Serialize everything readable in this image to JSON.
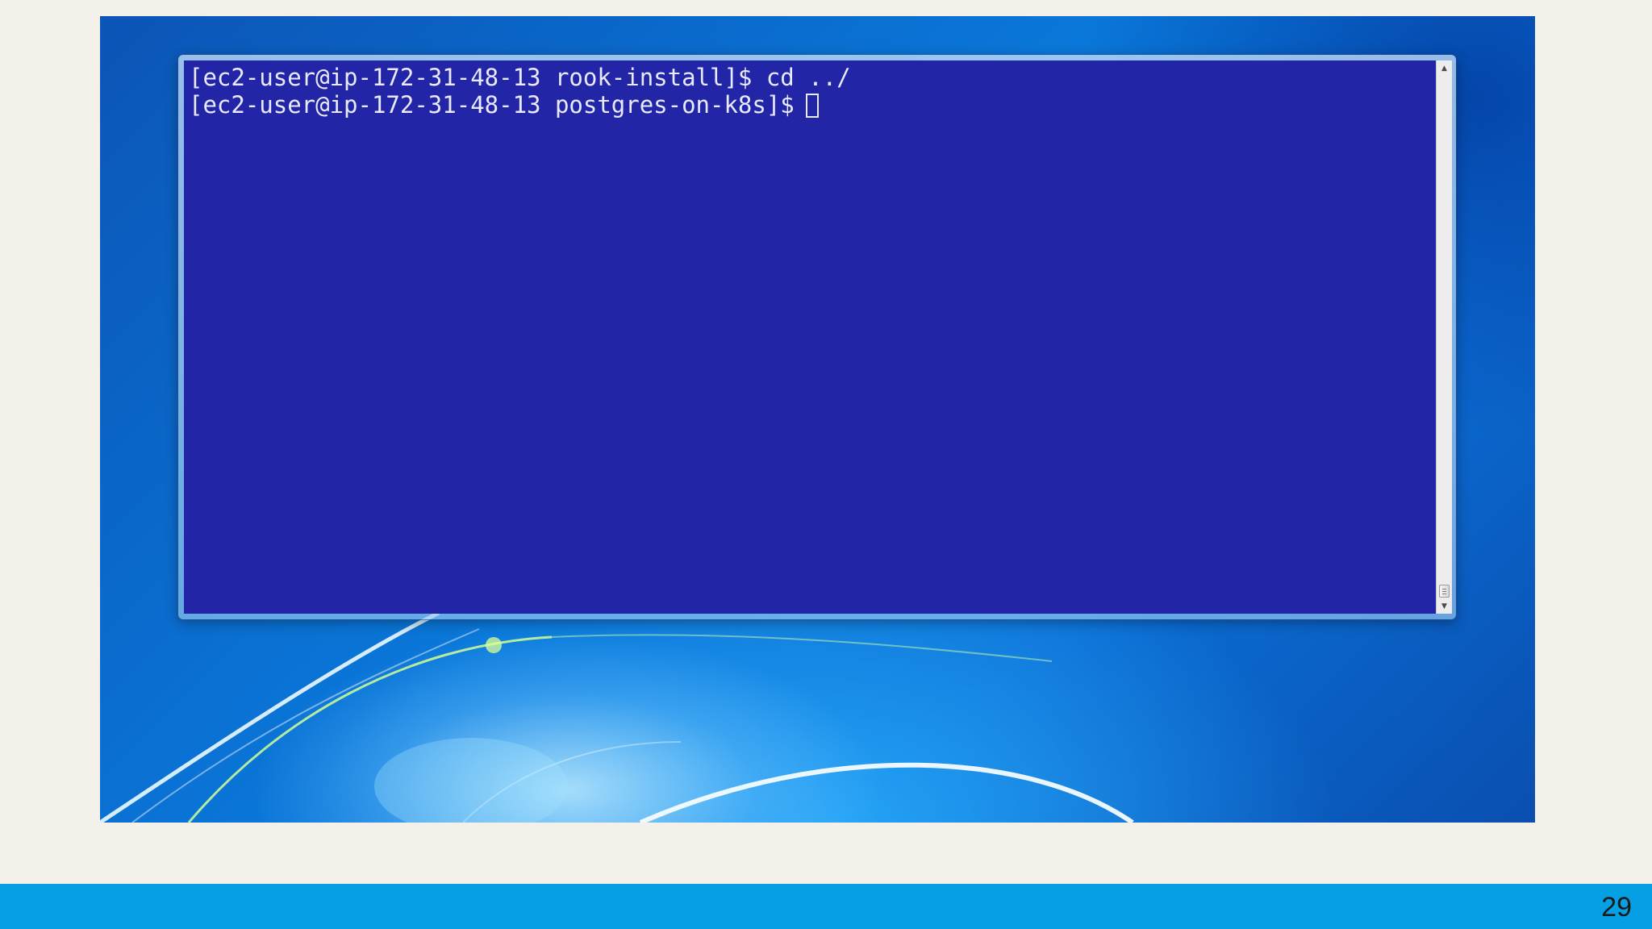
{
  "terminal": {
    "lines": [
      "[ec2-user@ip-172-31-48-13 rook-install]$ cd ../",
      "[ec2-user@ip-172-31-48-13 postgres-on-k8s]$"
    ]
  },
  "slide": {
    "page_number": "29"
  },
  "colors": {
    "terminal_background": "#2226a6",
    "terminal_text": "#e9e9ff",
    "footer_bar": "#059fe3",
    "page_background": "#f4f1ea"
  },
  "icons": {
    "scroll_up": "scroll-up-arrow-icon",
    "scroll_down": "scroll-down-arrow-icon"
  }
}
